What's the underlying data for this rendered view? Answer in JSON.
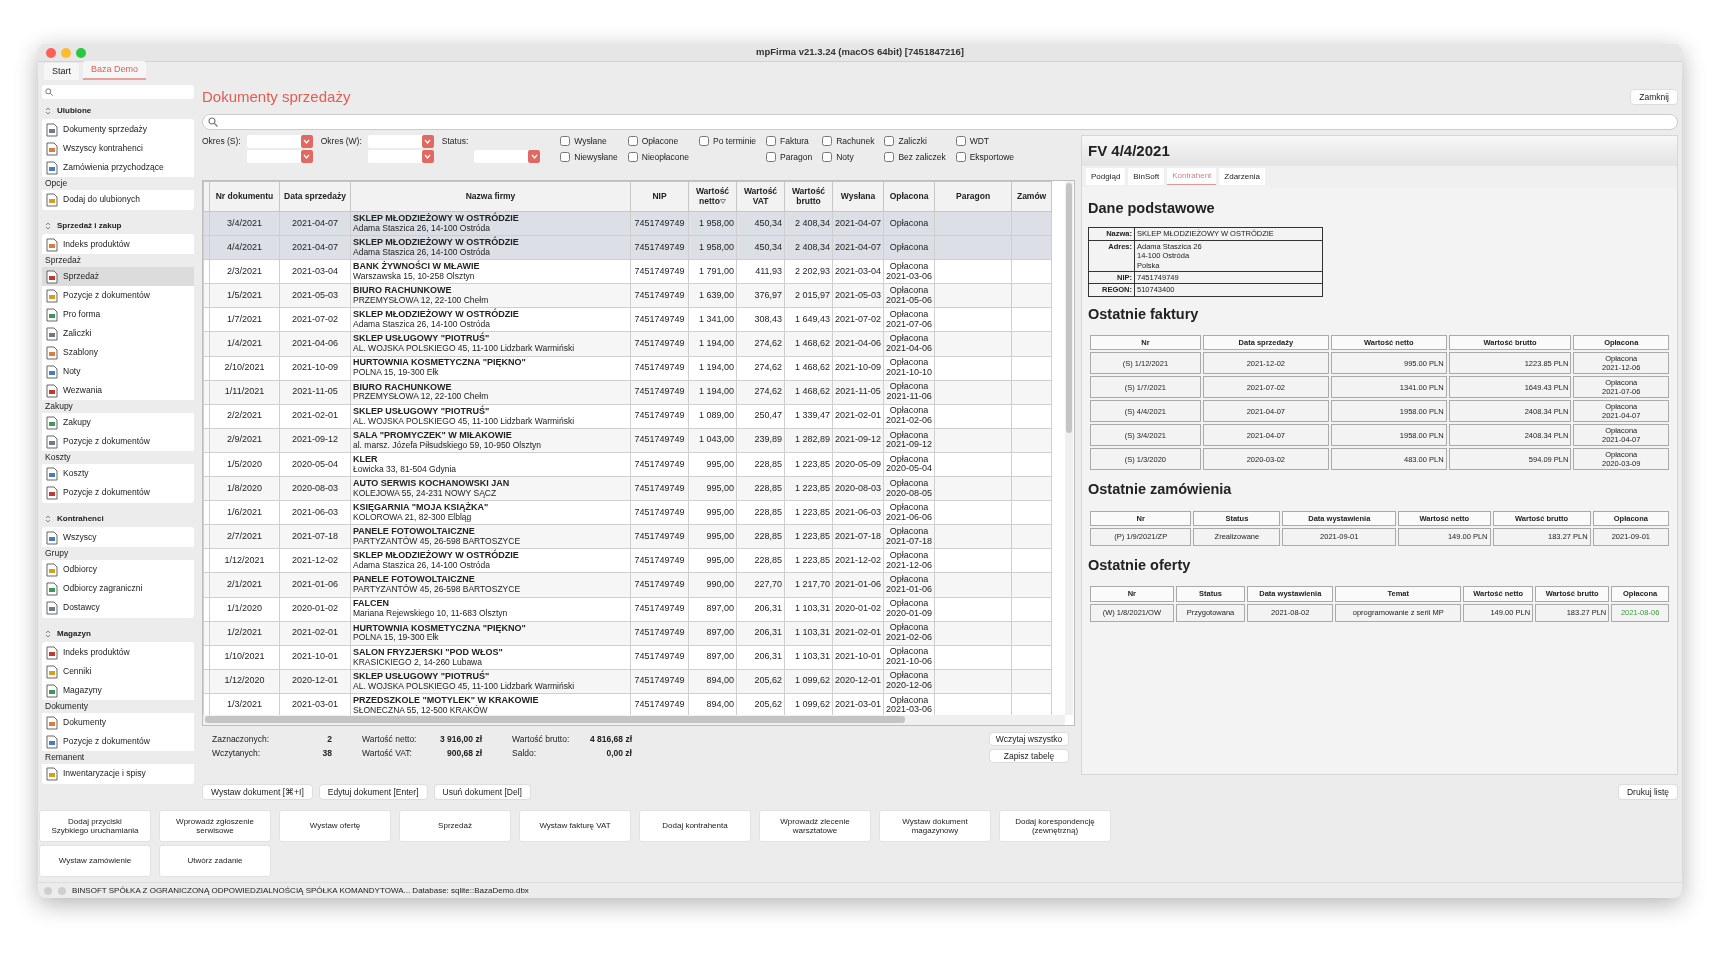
{
  "window": {
    "title": "mpFirma v21.3.24 (macOS 64bit) [7451847216]"
  },
  "tabs": [
    {
      "label": "Start",
      "selected": false
    },
    {
      "label": "Baza Demo",
      "selected": true
    }
  ],
  "sidebar": {
    "sections": [
      {
        "title": "Ulubione",
        "entries": [
          {
            "kind": "item",
            "label": "Dokumenty sprzedaży",
            "selected": false
          },
          {
            "kind": "item",
            "label": "Wszyscy kontrahenci",
            "selected": false
          },
          {
            "kind": "item",
            "label": "Zamówienia przychodzące",
            "selected": false
          },
          {
            "kind": "label",
            "label": "Opcje"
          },
          {
            "kind": "item",
            "label": "Dodaj do ulubionych",
            "selected": false
          }
        ]
      },
      {
        "title": "Sprzedaż i zakup",
        "entries": [
          {
            "kind": "item",
            "label": "Indeks produktów",
            "selected": false
          },
          {
            "kind": "label",
            "label": "Sprzedaż"
          },
          {
            "kind": "item",
            "label": "Sprzedaż",
            "selected": true
          },
          {
            "kind": "item",
            "label": "Pozycje z dokumentów",
            "selected": false
          },
          {
            "kind": "item",
            "label": "Pro forma",
            "selected": false
          },
          {
            "kind": "item",
            "label": "Zaliczki",
            "selected": false
          },
          {
            "kind": "item",
            "label": "Szablony",
            "selected": false
          },
          {
            "kind": "item",
            "label": "Noty",
            "selected": false
          },
          {
            "kind": "item",
            "label": "Wezwania",
            "selected": false
          },
          {
            "kind": "label",
            "label": "Zakupy"
          },
          {
            "kind": "item",
            "label": "Zakupy",
            "selected": false
          },
          {
            "kind": "item",
            "label": "Pozycje z dokumentów",
            "selected": false
          },
          {
            "kind": "label",
            "label": "Koszty"
          },
          {
            "kind": "item",
            "label": "Koszty",
            "selected": false
          },
          {
            "kind": "item",
            "label": "Pozycje z dokumentów",
            "selected": false
          }
        ]
      },
      {
        "title": "Kontrahenci",
        "entries": [
          {
            "kind": "item",
            "label": "Wszyscy",
            "selected": false
          },
          {
            "kind": "label",
            "label": "Grupy"
          },
          {
            "kind": "item",
            "label": "Odbiorcy",
            "selected": false
          },
          {
            "kind": "item",
            "label": "Odbiorcy zagraniczni",
            "selected": false
          },
          {
            "kind": "item",
            "label": "Dostawcy",
            "selected": false
          }
        ]
      },
      {
        "title": "Magazyn",
        "entries": [
          {
            "kind": "item",
            "label": "Indeks produktów",
            "selected": false
          },
          {
            "kind": "item",
            "label": "Cenniki",
            "selected": false
          },
          {
            "kind": "item",
            "label": "Magazyny",
            "selected": false
          },
          {
            "kind": "label",
            "label": "Dokumenty"
          },
          {
            "kind": "item",
            "label": "Dokumenty",
            "selected": false
          },
          {
            "kind": "item",
            "label": "Pozycje z dokumentów",
            "selected": false
          },
          {
            "kind": "label",
            "label": "Remanent"
          },
          {
            "kind": "item",
            "label": "Inwentaryzacje i spisy",
            "selected": false
          }
        ]
      }
    ]
  },
  "page": {
    "title": "Dokumenty sprzedaży",
    "close_button": "Zamknij"
  },
  "filters": {
    "selects": [
      {
        "label": "Okres (S):",
        "kind": "range"
      },
      {
        "label": "Okres (W):",
        "kind": "range"
      },
      {
        "label": "Status:",
        "kind": "single"
      }
    ],
    "checkbox_columns": [
      [
        {
          "label": "Wysłane",
          "checked": false
        },
        {
          "label": "Niewysłane",
          "checked": false
        }
      ],
      [
        {
          "label": "Opłacone",
          "checked": false
        },
        {
          "label": "Nieopłacone",
          "checked": false
        }
      ],
      [
        {
          "label": "Po terminie",
          "checked": false
        }
      ],
      [
        {
          "label": "Faktura",
          "checked": false
        },
        {
          "label": "Paragon",
          "checked": false
        }
      ],
      [
        {
          "label": "Rachunek",
          "checked": false
        },
        {
          "label": "Noty",
          "checked": false
        }
      ],
      [
        {
          "label": "Zaliczki",
          "checked": false
        },
        {
          "label": "Bez zaliczek",
          "checked": false
        }
      ],
      [
        {
          "label": "WDT",
          "checked": false
        },
        {
          "label": "Eksportowe",
          "checked": false
        }
      ]
    ]
  },
  "table": {
    "columns": [
      {
        "label": "Nr dokumentu"
      },
      {
        "label": "Data sprzedaży"
      },
      {
        "label": "Nazwa firmy"
      },
      {
        "label": "NIP"
      },
      {
        "label": "Wartość netto",
        "sorted": true
      },
      {
        "label": "Wartość VAT"
      },
      {
        "label": "Wartość brutto"
      },
      {
        "label": "Wysłana"
      },
      {
        "label": "Opłacona"
      },
      {
        "label": "Paragon"
      },
      {
        "label": "Zamów"
      }
    ],
    "rows": [
      {
        "nr": "3/4/2021",
        "date": "2021-04-07",
        "name": "SKLEP MŁODZIEŻOWY W OSTRÓDZIE",
        "address": "Adama Staszica 26, 14-100 Ostróda",
        "nip": "7451749749",
        "net": "1 958,00",
        "vat": "450,34",
        "gross": "2 408,34",
        "sent": "2021-04-07",
        "paid": "Opłacona",
        "selected": true
      },
      {
        "nr": "4/4/2021",
        "date": "2021-04-07",
        "name": "SKLEP MŁODZIEŻOWY W OSTRÓDZIE",
        "address": "Adama Staszica 26, 14-100 Ostróda",
        "nip": "7451749749",
        "net": "1 958,00",
        "vat": "450,34",
        "gross": "2 408,34",
        "sent": "2021-04-07",
        "paid": "Opłacona",
        "selected": true
      },
      {
        "nr": "2/3/2021",
        "date": "2021-03-04",
        "name": "BANK ŻYWNOŚCI W MŁAWIE",
        "address": "Warszawska 15, 10-258 Olsztyn",
        "nip": "7451749749",
        "net": "1 791,00",
        "vat": "411,93",
        "gross": "2 202,93",
        "sent": "2021-03-04",
        "paid": "Opłacona",
        "paid_date": "2021-03-06",
        "selected": false
      },
      {
        "nr": "1/5/2021",
        "date": "2021-05-03",
        "name": "BIURO RACHUNKOWE",
        "address": "PRZEMYSŁOWA 12, 22-100 Chełm",
        "nip": "7451749749",
        "net": "1 639,00",
        "vat": "376,97",
        "gross": "2 015,97",
        "sent": "2021-05-03",
        "paid": "Opłacona",
        "paid_date": "2021-05-06",
        "selected": false
      },
      {
        "nr": "1/7/2021",
        "date": "2021-07-02",
        "name": "SKLEP MŁODZIEŻOWY W OSTRÓDZIE",
        "address": "Adama Staszica 26, 14-100 Ostróda",
        "nip": "7451749749",
        "net": "1 341,00",
        "vat": "308,43",
        "gross": "1 649,43",
        "sent": "2021-07-02",
        "paid": "Opłacona",
        "paid_date": "2021-07-06",
        "selected": false
      },
      {
        "nr": "1/4/2021",
        "date": "2021-04-06",
        "name": "SKLEP USŁUGOWY \"PIOTRUŚ\"",
        "address": "AL. WOJSKA POLSKIEGO 45, 11-100 Lidzbark Warmiński",
        "nip": "7451749749",
        "net": "1 194,00",
        "vat": "274,62",
        "gross": "1 468,62",
        "sent": "2021-04-06",
        "paid": "Opłacona",
        "paid_date": "2021-04-06",
        "selected": false
      },
      {
        "nr": "2/10/2021",
        "date": "2021-10-09",
        "name": "HURTOWNIA KOSMETYCZNA \"PIĘKNO\"",
        "address": "POLNA 15, 19-300 Ełk",
        "nip": "7451749749",
        "net": "1 194,00",
        "vat": "274,62",
        "gross": "1 468,62",
        "sent": "2021-10-09",
        "paid": "Opłacona",
        "paid_date": "2021-10-10",
        "selected": false
      },
      {
        "nr": "1/11/2021",
        "date": "2021-11-05",
        "name": "BIURO RACHUNKOWE",
        "address": "PRZEMYSŁOWA 12, 22-100 Chełm",
        "nip": "7451749749",
        "net": "1 194,00",
        "vat": "274,62",
        "gross": "1 468,62",
        "sent": "2021-11-05",
        "paid": "Opłacona",
        "paid_date": "2021-11-06",
        "selected": false
      },
      {
        "nr": "2/2/2021",
        "date": "2021-02-01",
        "name": "SKLEP USŁUGOWY \"PIOTRUŚ\"",
        "address": "AL. WOJSKA POLSKIEGO 45, 11-100 Lidzbark Warmiński",
        "nip": "7451749749",
        "net": "1 089,00",
        "vat": "250,47",
        "gross": "1 339,47",
        "sent": "2021-02-01",
        "paid": "Opłacona",
        "paid_date": "2021-02-06",
        "selected": false
      },
      {
        "nr": "2/9/2021",
        "date": "2021-09-12",
        "name": "SALA \"PROMYCZEK\" W MIŁAKOWIE",
        "address": "al. marsz. Józefa Piłsudskiego 59, 10-950 Olsztyn",
        "nip": "7451749749",
        "net": "1 043,00",
        "vat": "239,89",
        "gross": "1 282,89",
        "sent": "2021-09-12",
        "paid": "Opłacona",
        "paid_date": "2021-09-12",
        "selected": false
      },
      {
        "nr": "1/5/2020",
        "date": "2020-05-04",
        "name": "KLER",
        "address": "Łowicka 33, 81-504 Gdynia",
        "nip": "7451749749",
        "net": "995,00",
        "vat": "228,85",
        "gross": "1 223,85",
        "sent": "2020-05-09",
        "paid": "Opłacona",
        "paid_date": "2020-05-04",
        "selected": false
      },
      {
        "nr": "1/8/2020",
        "date": "2020-08-03",
        "name": "AUTO SERWIS KOCHANOWSKI JAN",
        "address": "KOLEJOWA 55, 24-231 NOWY SĄCZ",
        "nip": "7451749749",
        "net": "995,00",
        "vat": "228,85",
        "gross": "1 223,85",
        "sent": "2020-08-03",
        "paid": "Opłacona",
        "paid_date": "2020-08-05",
        "selected": false
      },
      {
        "nr": "1/6/2021",
        "date": "2021-06-03",
        "name": "KSIĘGARNIA \"MOJA KSIĄŻKA\"",
        "address": "KOLOROWA 21, 82-300 Elbląg",
        "nip": "7451749749",
        "net": "995,00",
        "vat": "228,85",
        "gross": "1 223,85",
        "sent": "2021-06-03",
        "paid": "Opłacona",
        "paid_date": "2021-06-06",
        "selected": false
      },
      {
        "nr": "2/7/2021",
        "date": "2021-07-18",
        "name": "PANELE FOTOWOLTAICZNE",
        "address": "PARTYZANTÓW 45, 26-598 BARTOSZYCE",
        "nip": "7451749749",
        "net": "995,00",
        "vat": "228,85",
        "gross": "1 223,85",
        "sent": "2021-07-18",
        "paid": "Opłacona",
        "paid_date": "2021-07-18",
        "selected": false
      },
      {
        "nr": "1/12/2021",
        "date": "2021-12-02",
        "name": "SKLEP MŁODZIEŻOWY W OSTRÓDZIE",
        "address": "Adama Staszica 26, 14-100 Ostróda",
        "nip": "7451749749",
        "net": "995,00",
        "vat": "228,85",
        "gross": "1 223,85",
        "sent": "2021-12-02",
        "paid": "Opłacona",
        "paid_date": "2021-12-06",
        "selected": false
      },
      {
        "nr": "2/1/2021",
        "date": "2021-01-06",
        "name": "PANELE FOTOWOLTAICZNE",
        "address": "PARTYZANTÓW 45, 26-598 BARTOSZYCE",
        "nip": "7451749749",
        "net": "990,00",
        "vat": "227,70",
        "gross": "1 217,70",
        "sent": "2021-01-06",
        "paid": "Opłacona",
        "paid_date": "2021-01-06",
        "selected": false
      },
      {
        "nr": "1/1/2020",
        "date": "2020-01-02",
        "name": "FALCEN",
        "address": "Mariana Rejewskiego 10, 11-683 Olsztyn",
        "nip": "7451749749",
        "net": "897,00",
        "vat": "206,31",
        "gross": "1 103,31",
        "sent": "2020-01-02",
        "paid": "Opłacona",
        "paid_date": "2020-01-09",
        "selected": false
      },
      {
        "nr": "1/2/2021",
        "date": "2021-02-01",
        "name": "HURTOWNIA KOSMETYCZNA \"PIĘKNO\"",
        "address": "POLNA 15, 19-300 Ełk",
        "nip": "7451749749",
        "net": "897,00",
        "vat": "206,31",
        "gross": "1 103,31",
        "sent": "2021-02-01",
        "paid": "Opłacona",
        "paid_date": "2021-02-06",
        "selected": false
      },
      {
        "nr": "1/10/2021",
        "date": "2021-10-01",
        "name": "SALON FRYZJERSKI \"POD WŁOS\"",
        "address": "KRASICKIEGO 2, 14-260 Lubawa",
        "nip": "7451749749",
        "net": "897,00",
        "vat": "206,31",
        "gross": "1 103,31",
        "sent": "2021-10-01",
        "paid": "Opłacona",
        "paid_date": "2021-10-06",
        "selected": false
      },
      {
        "nr": "1/12/2020",
        "date": "2020-12-01",
        "name": "SKLEP USŁUGOWY \"PIOTRUŚ\"",
        "address": "AL. WOJSKA POLSKIEGO 45, 11-100 Lidzbark Warmiński",
        "nip": "7451749749",
        "net": "894,00",
        "vat": "205,62",
        "gross": "1 099,62",
        "sent": "2020-12-01",
        "paid": "Opłacona",
        "paid_date": "2020-12-06",
        "selected": false
      },
      {
        "nr": "1/3/2021",
        "date": "2021-03-01",
        "name": "PRZEDSZKOLE \"MOTYLEK\" W KRAKOWIE",
        "address": "SŁONECZNA 55, 12-500 KRAKÓW",
        "nip": "7451749749",
        "net": "894,00",
        "vat": "205,62",
        "gross": "1 099,62",
        "sent": "2021-03-01",
        "paid": "Opłacona",
        "paid_date": "2021-03-06",
        "selected": false
      }
    ]
  },
  "summary": [
    {
      "label": "Zaznaczonych:",
      "value": "2"
    },
    {
      "label": "Wczytanych:",
      "value": "38"
    },
    {
      "label": "Wartość netto:",
      "value": "3 916,00 zł"
    },
    {
      "label": "Wartość VAT:",
      "value": "900,68 zł"
    },
    {
      "label": "Wartość brutto:",
      "value": "4 816,68 zł"
    },
    {
      "label": "Saldo:",
      "value": "0,00 zł"
    }
  ],
  "table_buttons": [
    "Wczytaj wszystko",
    "Zapisz tabelę"
  ],
  "actions": [
    "Wystaw dokument [⌘+I]",
    "Edytuj dokument [Enter]",
    "Usuń dokument [Del]"
  ],
  "print_button": "Drukuj listę",
  "quick_buttons": [
    "Dodaj przyciski\nSzybkiego uruchamiania",
    "Wprowadź zgłoszenie\nserwisowe",
    "Wystaw ofertę",
    "Sprzedaż",
    "Wystaw fakturę VAT",
    "Dodaj kontrahenta",
    "Wprowadź zlecenie\nwarsztatowe",
    "Wystaw dokument\nmagazynowy",
    "Dodaj korespondencję\n(zewnętrzną)",
    "Wystaw zamówienie",
    "Utwórz zadanie"
  ],
  "status_bar": "BINSOFT SPÓŁKA Z OGRANICZONĄ ODPOWIEDZIALNOŚCIĄ SPÓŁKA KOMANDYTOWA... Database: sqlite::BazaDemo.dbx",
  "detail": {
    "title": "FV 4/4/2021",
    "tabs": [
      {
        "label": "Podgląd",
        "selected": false
      },
      {
        "label": "BinSoft",
        "selected": false
      },
      {
        "label": "Kontrahent",
        "selected": true
      },
      {
        "label": "Zdarzenia",
        "selected": false
      }
    ],
    "basic": {
      "heading": "Dane podstawowe",
      "fields": [
        {
          "label": "Nazwa:",
          "lines": [
            "SKLEP MŁODZIEŻOWY W OSTRÓDZIE"
          ]
        },
        {
          "label": "Adres:",
          "lines": [
            "Adama Staszica 26",
            "14-100 Ostróda",
            "Polska"
          ]
        },
        {
          "label": "NIP:",
          "lines": [
            "7451749749"
          ]
        },
        {
          "label": "REGON:",
          "lines": [
            "510743400"
          ]
        }
      ]
    },
    "tables": [
      {
        "heading": "Ostatnie faktury",
        "columns": [
          {
            "label": "Nr"
          },
          {
            "label": "Data sprzedaży"
          },
          {
            "label": "Wartość netto",
            "kind": "amount"
          },
          {
            "label": "Wartość brutto",
            "kind": "amount"
          },
          {
            "label": "Opłacona"
          }
        ],
        "rows": [
          {
            "cells": [
              {
                "prefix": "(S)",
                "link": "1/12/2021"
              },
              [
                "2021-12-02"
              ],
              [
                "995.00 PLN"
              ],
              [
                "1223.85 PLN"
              ],
              [
                "Opłacona",
                "2021-12-06"
              ]
            ]
          },
          {
            "cells": [
              {
                "prefix": "(S)",
                "link": "1/7/2021"
              },
              [
                "2021-07-02"
              ],
              [
                "1341.00 PLN"
              ],
              [
                "1649.43 PLN"
              ],
              [
                "Opłacona",
                "2021-07-06"
              ]
            ]
          },
          {
            "cells": [
              {
                "prefix": "(S)",
                "link": "4/4/2021"
              },
              [
                "2021-04-07"
              ],
              [
                "1958.00 PLN"
              ],
              [
                "2408.34 PLN"
              ],
              [
                "Opłacona",
                "2021-04-07"
              ]
            ]
          },
          {
            "cells": [
              {
                "prefix": "(S)",
                "link": "3/4/2021"
              },
              [
                "2021-04-07"
              ],
              [
                "1958.00 PLN"
              ],
              [
                "2408.34 PLN"
              ],
              [
                "Opłacona",
                "2021-04-07"
              ]
            ]
          },
          {
            "cells": [
              {
                "prefix": "(S)",
                "link": "1/3/2020"
              },
              [
                "2020-03-02"
              ],
              [
                "483.00 PLN"
              ],
              [
                "594.09 PLN"
              ],
              [
                "Opłacona",
                "2020-03-09"
              ]
            ]
          }
        ]
      },
      {
        "heading": "Ostatnie zamówienia",
        "columns": [
          {
            "label": "Nr"
          },
          {
            "label": "Status"
          },
          {
            "label": "Data wystawienia"
          },
          {
            "label": "Wartość netto",
            "kind": "amount"
          },
          {
            "label": "Wartość brutto",
            "kind": "amount"
          },
          {
            "label": "Opłacona"
          }
        ],
        "rows": [
          {
            "cells": [
              {
                "prefix": "(P)",
                "link": "1/9/2021/ZP"
              },
              [
                "Zrealizowane"
              ],
              [
                "2021-09-01"
              ],
              [
                "149.00 PLN"
              ],
              [
                "183.27 PLN"
              ],
              [
                "2021-09-01"
              ]
            ]
          }
        ]
      },
      {
        "heading": "Ostatnie oferty",
        "columns": [
          {
            "label": "Nr"
          },
          {
            "label": "Status"
          },
          {
            "label": "Data wystawienia"
          },
          {
            "label": "Temat"
          },
          {
            "label": "Wartość netto",
            "kind": "amount"
          },
          {
            "label": "Wartość brutto",
            "kind": "amount"
          },
          {
            "label": "Opłacona"
          }
        ],
        "rows": [
          {
            "cells": [
              {
                "prefix": "(W)",
                "link": "1/8/2021/OW"
              },
              [
                "Przygotowana"
              ],
              [
                "2021-08-02"
              ],
              [
                "oprogramowanie z serii MP"
              ],
              [
                "149.00 PLN"
              ],
              [
                "183.27 PLN"
              ],
              [
                "2021-08-06"
              ]
            ],
            "highlight": true
          }
        ]
      }
    ]
  }
}
